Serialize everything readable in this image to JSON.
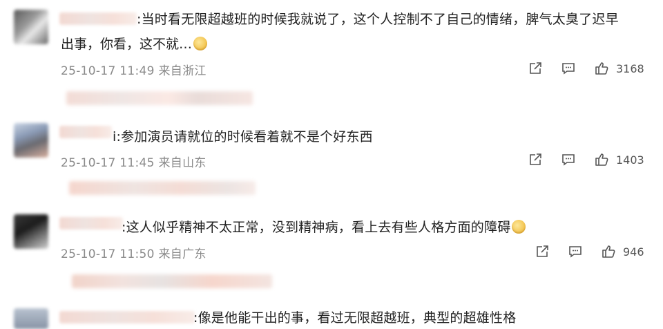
{
  "comments": [
    {
      "text_line1": ":当时看无限超越班的时候我就说了，这个人控制不了自己的情绪，脾气太臭了迟早",
      "text_line2": "出事，你看，这不就…",
      "meta": "25-10-17 11:49 来自浙江",
      "likes": "3168"
    },
    {
      "text_line1": "i:参加演员请就位的时候看着就不是个好东西",
      "meta": "25-10-17 11:45 来自山东",
      "likes": "1403"
    },
    {
      "text_line1": ":这人似乎精神不太正常，没到精神病，看上去有些人格方面的障碍",
      "meta": "25-10-17 11:50 来自广东",
      "likes": "946"
    },
    {
      "text_line1": ":像是他能干出的事，看过无限超越班，典型的超雄性格"
    }
  ],
  "icons": [
    "share-icon",
    "comment-icon",
    "like-icon"
  ],
  "colors": {
    "meta": "#8a8a8a",
    "text": "#222222",
    "blur_pink": "#f3d9d2"
  }
}
